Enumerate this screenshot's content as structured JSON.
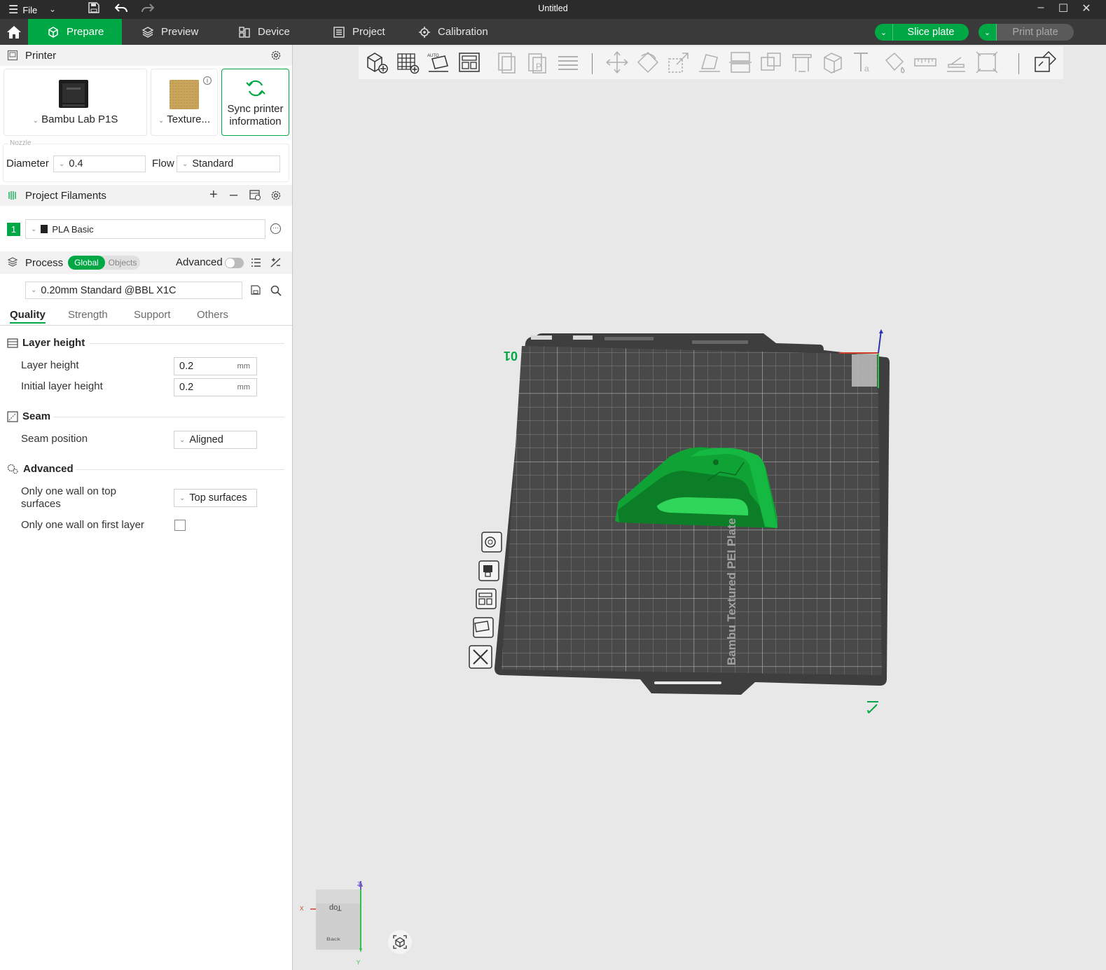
{
  "app": {
    "window_title": "Untitled",
    "file_menu": "File"
  },
  "nav": {
    "tabs": [
      {
        "label": "Prepare",
        "active": true
      },
      {
        "label": "Preview"
      },
      {
        "label": "Device"
      },
      {
        "label": "Project"
      },
      {
        "label": "Calibration"
      }
    ],
    "slice_button": "Slice plate",
    "print_button": "Print plate"
  },
  "printer": {
    "section_title": "Printer",
    "printer_name": "Bambu Lab P1S",
    "plate_name": "Texture...",
    "sync_label_line1": "Sync printer",
    "sync_label_line2": "information"
  },
  "nozzle": {
    "group_label": "Nozzle",
    "diameter_label": "Diameter",
    "diameter_value": "0.4",
    "flow_label": "Flow",
    "flow_value": "Standard"
  },
  "filaments": {
    "section_title": "Project Filaments",
    "items": [
      {
        "index": "1",
        "name": "PLA Basic",
        "color": "#00a845"
      }
    ]
  },
  "process": {
    "section_title": "Process",
    "toggle_global": "Global",
    "toggle_objects": "Objects",
    "advanced_label": "Advanced",
    "preset": "0.20mm Standard @BBL X1C",
    "tabs": [
      "Quality",
      "Strength",
      "Support",
      "Others"
    ],
    "groups": {
      "layer_height": {
        "title": "Layer height",
        "layer_height_label": "Layer height",
        "layer_height_value": "0.2",
        "initial_layer_height_label": "Initial layer height",
        "initial_layer_height_value": "0.2",
        "unit": "mm"
      },
      "seam": {
        "title": "Seam",
        "seam_position_label": "Seam position",
        "seam_position_value": "Aligned"
      },
      "advanced": {
        "title": "Advanced",
        "one_wall_top_label_line1": "Only one wall on top",
        "one_wall_top_label_line2": "surfaces",
        "one_wall_top_value": "Top surfaces",
        "one_wall_first_label": "Only one wall on first layer",
        "one_wall_first_checked": false
      }
    }
  },
  "viewport": {
    "plate_number": "01",
    "plate_label": "Bambu Textured PEI Plate",
    "cube_top": "Top",
    "cube_back": "Back",
    "axis_z": "Z",
    "axis_y": "Y",
    "axis_x": "X",
    "model_color": "#0fa335",
    "accent": "#00a845"
  }
}
